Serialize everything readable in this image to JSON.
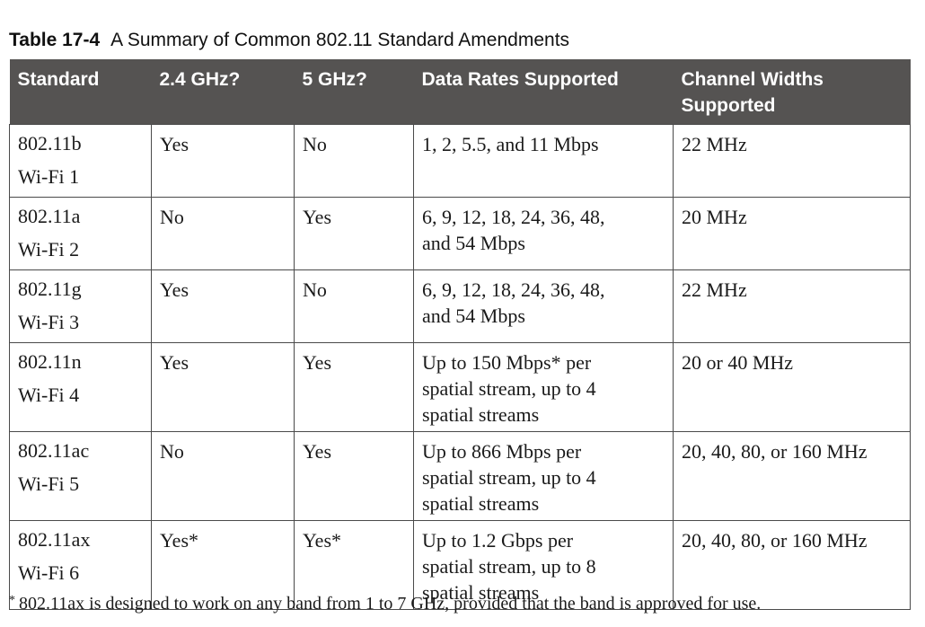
{
  "caption": {
    "number": "Table 17-4",
    "title": "A Summary of Common 802.11 Standard Amendments"
  },
  "table": {
    "headers": [
      "Standard",
      "2.4 GHz?",
      "5 GHz?",
      "Data Rates Supported",
      "Channel Widths Supported"
    ],
    "rows": [
      {
        "standard": "802.11b",
        "wifi": "Wi-Fi 1",
        "ghz24": "Yes",
        "ghz5": "No",
        "rates": [
          "1, 2, 5.5, and 11 Mbps"
        ],
        "widths": "22 MHz"
      },
      {
        "standard": "802.11a",
        "wifi": "Wi-Fi 2",
        "ghz24": "No",
        "ghz5": "Yes",
        "rates": [
          "6, 9, 12, 18, 24, 36, 48,",
          "and 54 Mbps"
        ],
        "widths": "20 MHz"
      },
      {
        "standard": "802.11g",
        "wifi": "Wi-Fi 3",
        "ghz24": "Yes",
        "ghz5": "No",
        "rates": [
          "6, 9, 12, 18, 24, 36, 48,",
          "and 54 Mbps"
        ],
        "widths": "22 MHz"
      },
      {
        "standard": "802.11n",
        "wifi": "Wi-Fi 4",
        "ghz24": "Yes",
        "ghz5": "Yes",
        "rates": [
          "Up to 150 Mbps* per",
          "spatial stream, up to 4",
          "spatial streams"
        ],
        "widths": "20 or 40 MHz"
      },
      {
        "standard": "802.11ac",
        "wifi": "Wi-Fi 5",
        "ghz24": "No",
        "ghz5": "Yes",
        "rates": [
          "Up to 866 Mbps per",
          "spatial stream, up to 4",
          "spatial streams"
        ],
        "widths": "20, 40, 80, or 160 MHz"
      },
      {
        "standard": "802.11ax",
        "wifi": "Wi-Fi 6",
        "ghz24": "Yes*",
        "ghz5": "Yes*",
        "rates": [
          "Up to 1.2 Gbps per",
          "spatial stream, up to 8",
          "spatial streams"
        ],
        "widths": "20, 40, 80, or 160 MHz"
      }
    ]
  },
  "footnote": {
    "mark": "*",
    "text": "802.11ax is designed to work on any band from 1 to 7 GHz, provided that the band is approved for use."
  }
}
